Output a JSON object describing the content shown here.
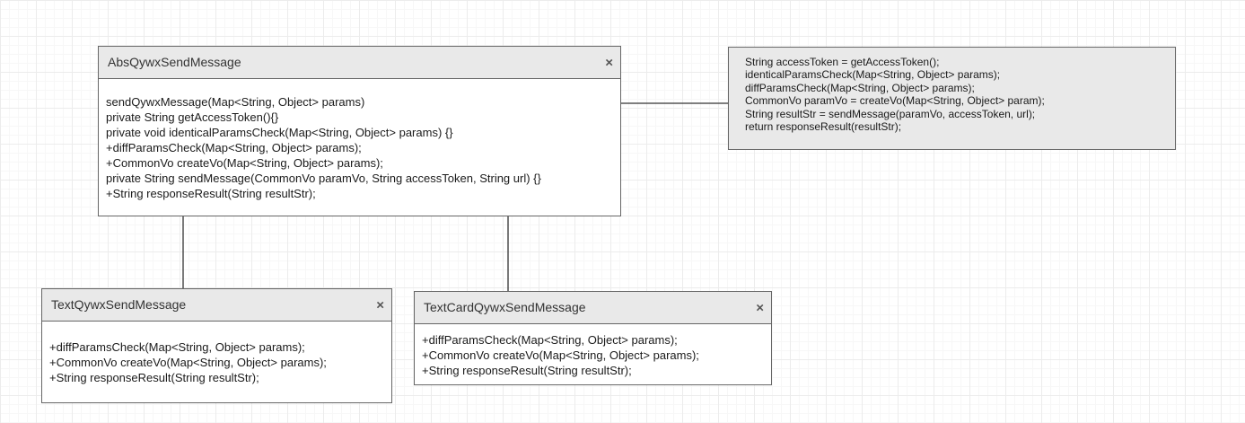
{
  "colors": {
    "border": "#666666",
    "header_bg": "#e9e9e9",
    "note_bg": "#e9e9e9",
    "text": "#1a1a1a",
    "connector": "#333333"
  },
  "icons": {
    "close": "×"
  },
  "classes": {
    "abs": {
      "name": "AbsQywxSendMessage",
      "methods": [
        "sendQywxMessage(Map<String, Object> params)",
        "private String getAccessToken(){}",
        "private void identicalParamsCheck(Map<String, Object> params) {}",
        "+diffParamsCheck(Map<String, Object> params);",
        "+CommonVo createVo(Map<String, Object> params);",
        "private String sendMessage(CommonVo paramVo, String accessToken, String url) {}",
        "+String responseResult(String resultStr);"
      ]
    },
    "text": {
      "name": "TextQywxSendMessage",
      "methods": [
        "+diffParamsCheck(Map<String, Object> params);",
        "+CommonVo createVo(Map<String, Object> params);",
        "+String responseResult(String resultStr);"
      ]
    },
    "textcard": {
      "name": "TextCardQywxSendMessage",
      "methods": [
        "+diffParamsCheck(Map<String, Object> params);",
        "+CommonVo createVo(Map<String, Object> params);",
        "+String responseResult(String resultStr);"
      ]
    }
  },
  "note": {
    "lines": [
      "String accessToken = getAccessToken();",
      "identicalParamsCheck(Map<String, Object> params);",
      "diffParamsCheck(Map<String, Object> params);",
      "CommonVo paramVo = createVo(Map<String, Object> param);",
      "String resultStr = sendMessage(paramVo, accessToken, url);",
      "return responseResult(resultStr);"
    ]
  }
}
